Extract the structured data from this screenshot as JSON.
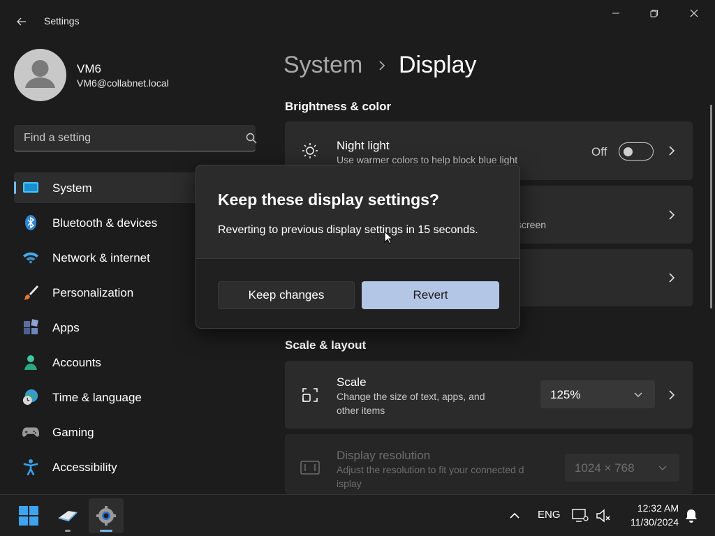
{
  "window": {
    "title": "Settings"
  },
  "profile": {
    "name": "VM6",
    "email": "VM6@collabnet.local"
  },
  "search": {
    "placeholder": "Find a setting"
  },
  "nav": {
    "items": [
      {
        "label": "System",
        "icon": "system-icon",
        "selected": true
      },
      {
        "label": "Bluetooth & devices",
        "icon": "bluetooth-icon"
      },
      {
        "label": "Network & internet",
        "icon": "wifi-icon"
      },
      {
        "label": "Personalization",
        "icon": "brush-icon"
      },
      {
        "label": "Apps",
        "icon": "apps-icon"
      },
      {
        "label": "Accounts",
        "icon": "account-icon"
      },
      {
        "label": "Time & language",
        "icon": "globe-clock-icon"
      },
      {
        "label": "Gaming",
        "icon": "gamepad-icon"
      },
      {
        "label": "Accessibility",
        "icon": "accessibility-icon"
      }
    ]
  },
  "breadcrumb": {
    "parent": "System",
    "current": "Display"
  },
  "sections": {
    "brightness": "Brightness & color",
    "scale_layout": "Scale & layout"
  },
  "night_light": {
    "title": "Night light",
    "desc": "Use warmer colors to help block blue light",
    "state_label": "Off",
    "on": false
  },
  "partial_card": {
    "desc_tail": "screen"
  },
  "scale": {
    "title": "Scale",
    "desc_line1": "Change the size of text, apps, and",
    "desc_line2": "other items",
    "value": "125%"
  },
  "resolution": {
    "title": "Display resolution",
    "desc_line1": "Adjust the resolution to fit your connected d",
    "desc_line2": "isplay",
    "value": "1024 × 768"
  },
  "dialog": {
    "title": "Keep these display settings?",
    "message": "Reverting to previous display settings in 15 seconds.",
    "keep_label": "Keep changes",
    "revert_label": "Revert"
  },
  "taskbar": {
    "language": "ENG",
    "time": "12:32 AM",
    "date": "11/30/2024"
  },
  "colors": {
    "accent": "#76b9ed",
    "primary_button": "#b4c6e6",
    "background": "#1c1c1c",
    "card": "#2b2b2b"
  }
}
